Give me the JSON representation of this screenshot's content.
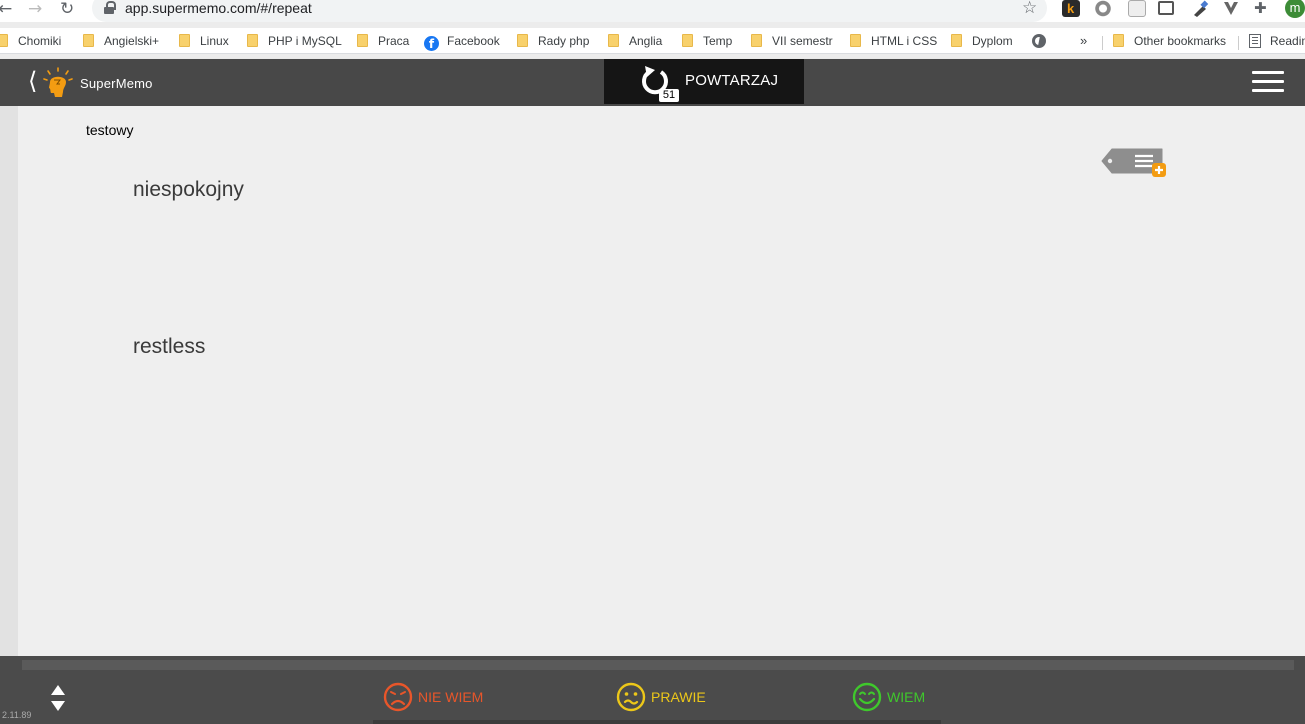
{
  "browser": {
    "url": "app.supermemo.com/#/repeat",
    "avatar_letter": "m",
    "bookmarks": [
      "Chomiki",
      "Angielski+",
      "Linux",
      "PHP i MySQL",
      "Praca",
      "Facebook",
      "Rady php",
      "Anglia",
      "Temp",
      "VII semestr",
      "HTML i CSS",
      "Dyplom"
    ],
    "overflow_label": "»",
    "other_bookmarks": "Other bookmarks",
    "reading_list": "Readin"
  },
  "app": {
    "brand": "SuperMemo",
    "repeat_label": "POWTARZAJ",
    "repeat_count": "51",
    "accent": "#f39c12"
  },
  "card": {
    "course": "testowy",
    "question": "niespokojny",
    "answer": "restless"
  },
  "grades": {
    "nie_wiem": "NIE WIEM",
    "prawie": "PRAWIE",
    "wiem": "WIEM",
    "colors": {
      "nie_wiem": "#e8562a",
      "prawie": "#ecc719",
      "wiem": "#3fc82c"
    }
  },
  "footer": {
    "version": "2.11.89"
  }
}
